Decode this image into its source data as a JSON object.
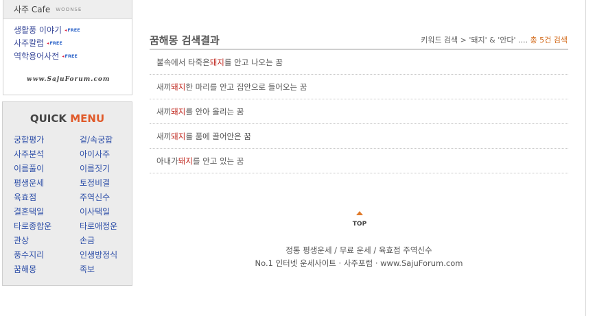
{
  "cafe": {
    "title": "사주 Cafe",
    "subtitle": "WOONSE",
    "free_label": "FREE",
    "links": [
      {
        "label": "생활풍 이야기"
      },
      {
        "label": "사주칼럼"
      },
      {
        "label": "역학용어사전"
      }
    ],
    "logo_text": "www.SajuForum.com"
  },
  "quick_menu": {
    "title_quick": "QUICK",
    "title_menu": "MENU",
    "items": [
      "궁합평가",
      "겉/속궁합",
      "사주분석",
      "아이사주",
      "이름풀이",
      "이름짓기",
      "평생운세",
      "토정비결",
      "육효점",
      "주역신수",
      "결혼택일",
      "이사택일",
      "타로종합운",
      "타로애정운",
      "관상",
      "손금",
      "풍수지리",
      "인생방정식",
      "꿈해몽",
      "족보"
    ]
  },
  "main": {
    "title": "꿈해몽 검색결과",
    "breadcrumb_prefix": "키워드 검색 > '돼지' & '안다' ....",
    "breadcrumb_count": "총 5건 검색",
    "results": [
      {
        "before": "불속에서 타죽은 ",
        "keyword": "돼지",
        "after": "를 안고 나오는 꿈"
      },
      {
        "before": "새끼 ",
        "keyword": "돼지",
        "after": " 한 마리를 안고 집안으로 들어오는 꿈"
      },
      {
        "before": "새끼 ",
        "keyword": "돼지",
        "after": "를 안아 올리는 꿈"
      },
      {
        "before": "새끼 ",
        "keyword": "돼지",
        "after": "를 품에 끌어안은 꿈"
      },
      {
        "before": "아내가 ",
        "keyword": "돼지",
        "after": "를 안고 있는 꿈"
      }
    ]
  },
  "top_button": {
    "label": "TOP"
  },
  "footer": {
    "line1": "정통 평생운세 / 무료 운세 / 육효점 주역신수",
    "line2": "No.1 인터넷 운세사이트 · 사주포럼 · www.SajuForum.com"
  }
}
